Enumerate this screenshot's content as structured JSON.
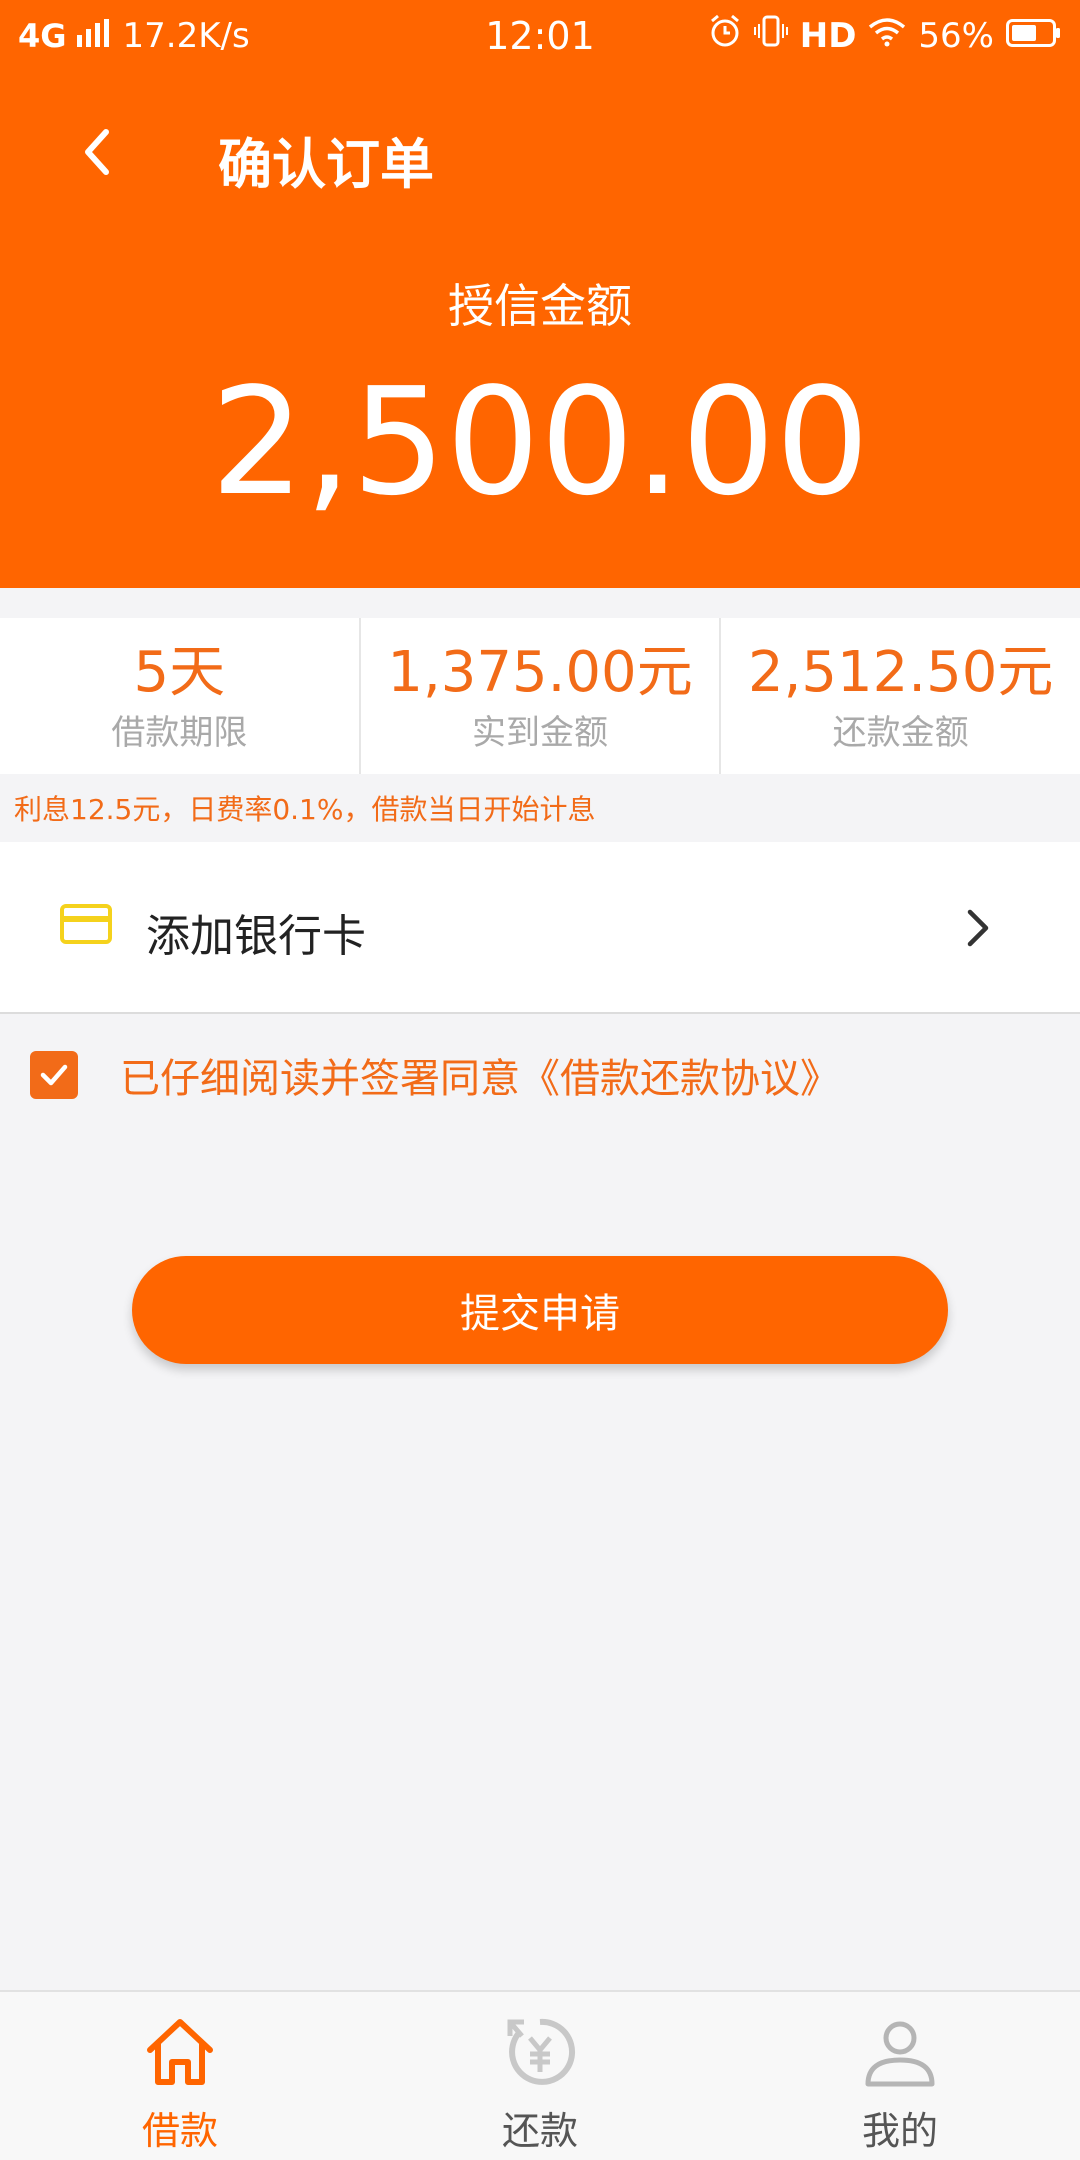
{
  "status_bar": {
    "network": "4G",
    "speed": "17.2K/s",
    "time": "12:01",
    "hd": "HD",
    "battery": "56%"
  },
  "nav": {
    "title": "确认订单"
  },
  "credit": {
    "label": "授信金额",
    "amount": "2,500.00"
  },
  "stats": [
    {
      "value": "5天",
      "label": "借款期限"
    },
    {
      "value": "1,375.00元",
      "label": "实到金额"
    },
    {
      "value": "2,512.50元",
      "label": "还款金额"
    }
  ],
  "interest_note": "利息12.5元，日费率0.1%，借款当日开始计息",
  "bank": {
    "label": "添加银行卡"
  },
  "agreement": {
    "text": "已仔细阅读并签署同意《借款还款协议》",
    "checked": true
  },
  "submit_label": "提交申请",
  "bottom_nav": [
    {
      "label": "借款",
      "icon": "home-icon",
      "active": true
    },
    {
      "label": "还款",
      "icon": "repay-yen-icon",
      "active": false
    },
    {
      "label": "我的",
      "icon": "user-icon",
      "active": false
    }
  ],
  "colors": {
    "brand": "#ff6500",
    "accent_text": "#f26b18",
    "card_icon": "#f5d21c"
  }
}
